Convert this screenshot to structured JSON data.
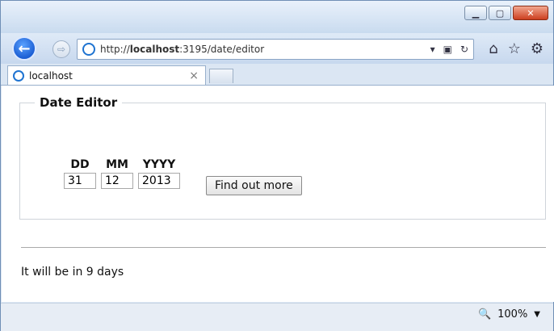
{
  "browser": {
    "address": {
      "prefix": "http://",
      "host": "localhost",
      "rest": ":3195/date/editor"
    },
    "tab": {
      "title": "localhost",
      "close": "×"
    },
    "status": {
      "zoom": "100%"
    }
  },
  "page": {
    "fieldset_title": "Date Editor",
    "fields": {
      "dd": {
        "label": "DD",
        "value": "31"
      },
      "mm": {
        "label": "MM",
        "value": "12"
      },
      "yyyy": {
        "label": "YYYY",
        "value": "2013"
      }
    },
    "button_label": "Find out more",
    "result_text": "It will be in 9 days"
  },
  "icons": {
    "back": "back-arrow-icon",
    "forward": "forward-arrow-icon",
    "home": "home-icon",
    "favorites": "star-icon",
    "tools": "gear-icon",
    "refresh": "refresh-icon"
  },
  "colors": {
    "accent": "#1c5fd4",
    "close": "#cc3f1f"
  }
}
